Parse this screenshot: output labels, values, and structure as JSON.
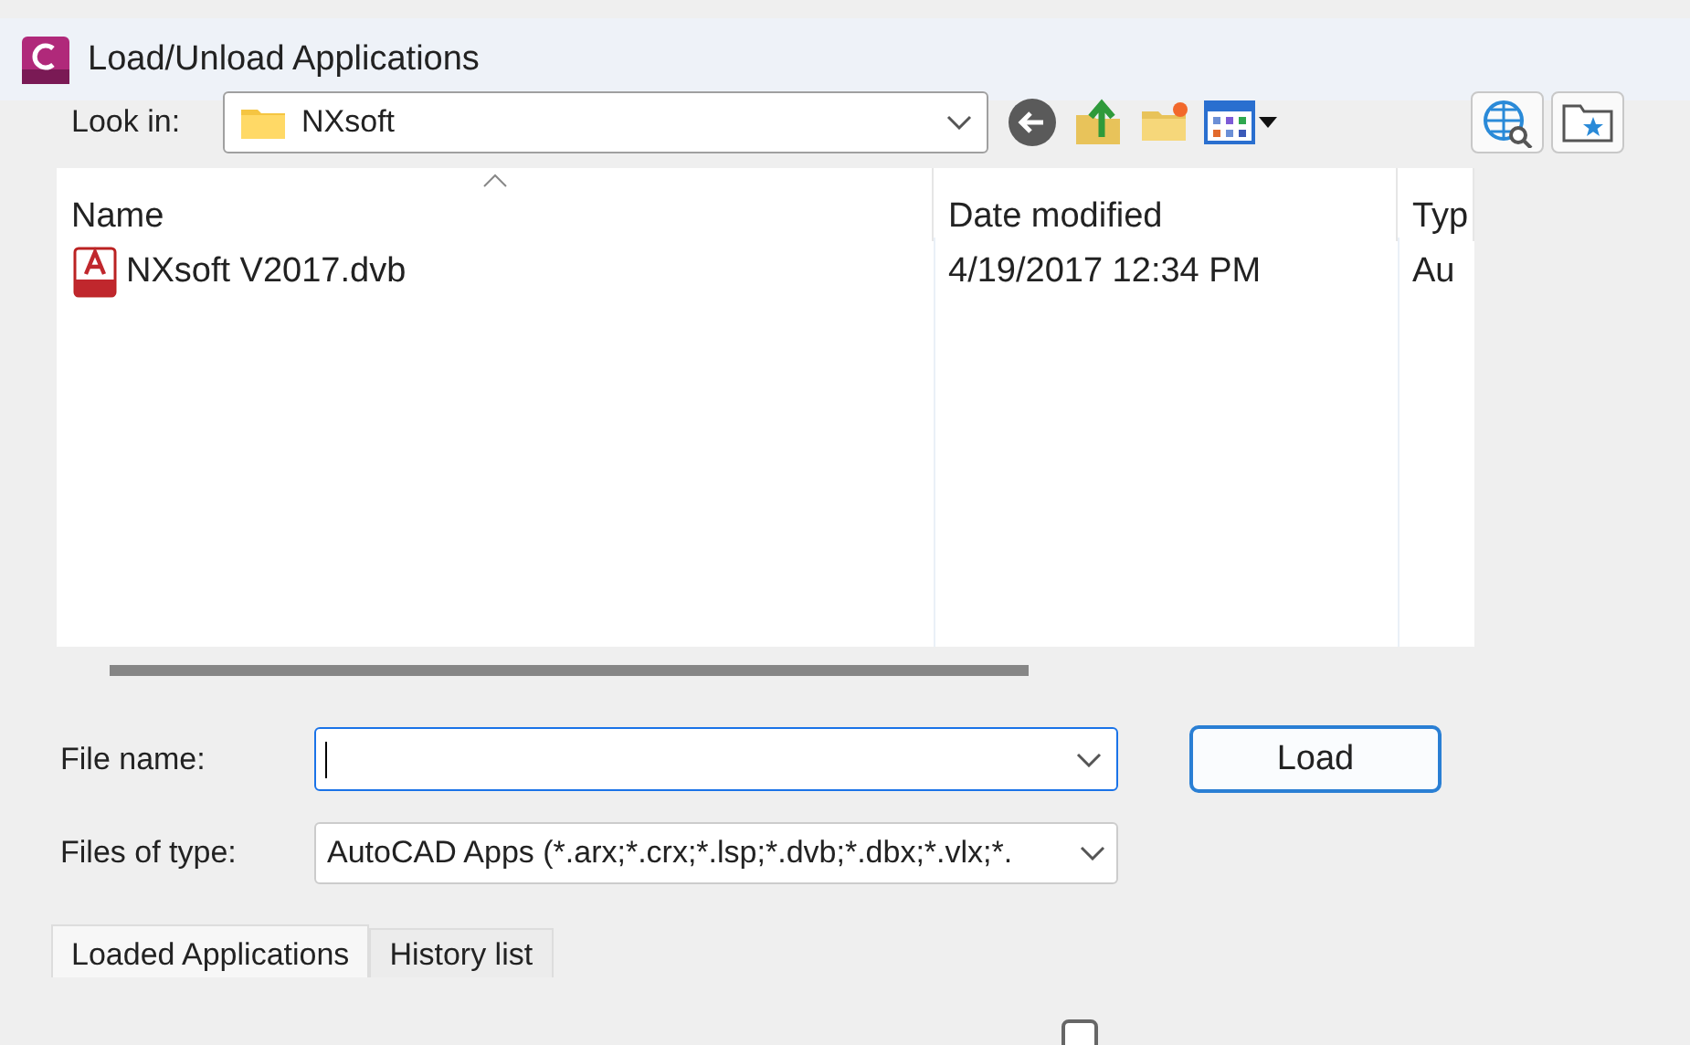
{
  "window": {
    "title": "Load/Unload Applications"
  },
  "look_in": {
    "label": "Look in:",
    "value": "NXsoft"
  },
  "file_list": {
    "columns": [
      {
        "label": "Name",
        "sorted": true
      },
      {
        "label": "Date modified",
        "sorted": false
      },
      {
        "label": "Typ",
        "sorted": false
      }
    ],
    "rows": [
      {
        "name": "NXsoft V2017.dvb",
        "date_modified": "4/19/2017 12:34 PM",
        "type": "Au"
      }
    ]
  },
  "file_name": {
    "label": "File name:"
  },
  "load_button": "Load",
  "files_of_type": {
    "label": "Files of type:",
    "value": "AutoCAD Apps (*.arx;*.crx;*.lsp;*.dvb;*.dbx;*.vlx;*."
  },
  "tabs": [
    {
      "label": "Loaded Applications",
      "selected": true
    },
    {
      "label": "History list",
      "selected": false
    }
  ],
  "checkbox": {
    "checked": false
  }
}
